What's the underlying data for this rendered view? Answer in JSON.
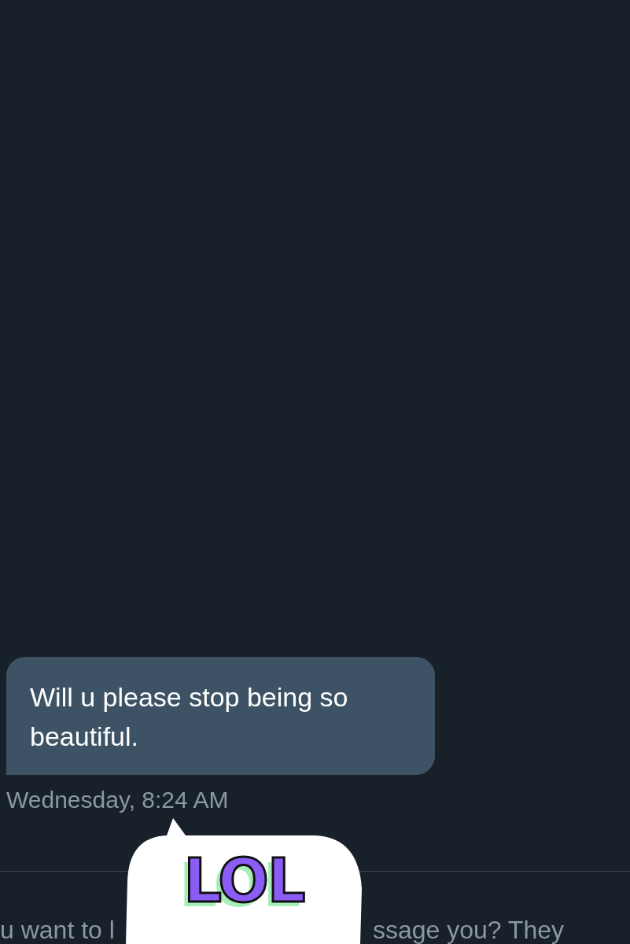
{
  "messages": [
    {
      "text": "Will u please stop being so beautiful.",
      "timestamp": "Wednesday, 8:24 AM"
    }
  ],
  "sticker": {
    "text": "LOL"
  },
  "footer_text": [
    "u want to l",
    "ssage you? They"
  ]
}
